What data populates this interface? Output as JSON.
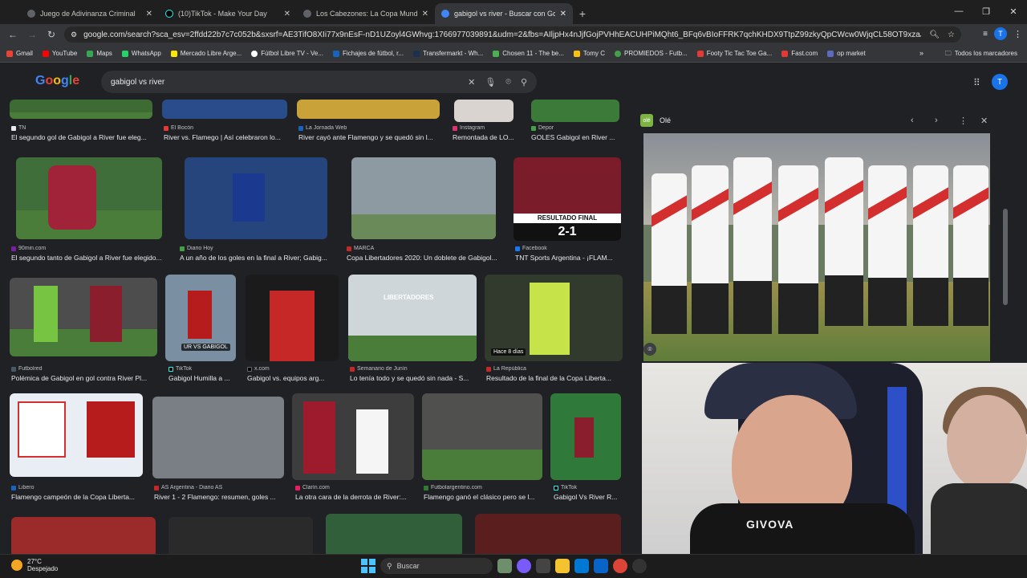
{
  "browser": {
    "tabs": [
      {
        "title": "Juego de Adivinanza Criminal",
        "color": "#5f6368"
      },
      {
        "title": "(10)TikTok - Make Your Day",
        "color": "#000000"
      },
      {
        "title": "Los Cabezones: La Copa Mundi",
        "color": "#5f6368"
      },
      {
        "title": "gabigol vs river - Buscar con Go",
        "color": "#4285f4"
      }
    ],
    "url": "google.com/search?sca_esv=2ffdd22b7c7c052b&sxsrf=AE3TifO8XIi77x9nEsF-nD1UZoyl4GWhvg:1766977039891&udm=2&fbs=AIljpHx4nJjfGojPVHhEACUHPiMQht6_BFq6vBIoFFRK7qchKHDX9TtpZ99zkyQpCWcw0WjqCL58OT9xzaJZWNwg8Tb-QmvZCiE...",
    "profile_initial": "T"
  },
  "bookmarks": [
    {
      "label": "Gmail",
      "color": "#ea4335"
    },
    {
      "label": "YouTube",
      "color": "#ff0000"
    },
    {
      "label": "Maps",
      "color": "#34a853"
    },
    {
      "label": "WhatsApp",
      "color": "#25d366"
    },
    {
      "label": "Mercado Libre Arge...",
      "color": "#ffe600"
    },
    {
      "label": "Fútbol Libre TV - Ve...",
      "color": "#ffffff"
    },
    {
      "label": "Fichajes de fútbol, r...",
      "color": "#1565c0"
    },
    {
      "label": "Transfermarkt - Wh...",
      "color": "#1a3151"
    },
    {
      "label": "Chosen 11 - The be...",
      "color": "#4caf50"
    },
    {
      "label": "Tomy C",
      "color": "#ffc107"
    },
    {
      "label": "PROMIEDOS - Futb...",
      "color": "#43a047"
    },
    {
      "label": "Footy Tic Tac Toe Ga...",
      "color": "#e53935"
    },
    {
      "label": "Fast.com",
      "color": "#e53935"
    },
    {
      "label": "op market",
      "color": "#5c6bc0"
    }
  ],
  "bookmarks_all": "Todos los marcadores",
  "google": {
    "logo": "Google",
    "query": "gabigol vs river"
  },
  "results": [
    {
      "source": "TN",
      "caption": "El segundo gol de Gabigol a River fue eleg..."
    },
    {
      "source": "El Bocón",
      "caption": "River vs. Flamego | Así celebraron lo..."
    },
    {
      "source": "La Jornada Web",
      "caption": "River cayó ante Flamengo y se quedó sin l..."
    },
    {
      "source": "Instagram",
      "caption": "Remontada de LO..."
    },
    {
      "source": "Depor",
      "caption": "GOLES Gabigol en River ..."
    },
    {
      "source": "90min.com",
      "caption": "El segundo tanto de Gabigol a River fue elegido..."
    },
    {
      "source": "Diario Hoy",
      "caption": "A un año de los goles en la final a River; Gabig..."
    },
    {
      "source": "MARCA",
      "caption": "Copa Libertadores 2020: Un doblete de Gabigol..."
    },
    {
      "source": "Facebook",
      "caption": "TNT Sports Argentina - ¡FLAM..."
    },
    {
      "source": "Futbolred",
      "caption": "Polémica de Gabigol en gol contra River Pl..."
    },
    {
      "source": "TikTok",
      "caption": "Gabigol Humilla a ..."
    },
    {
      "source": "x.com",
      "caption": "Gabigol vs. equipos arg..."
    },
    {
      "source": "Semanario de Junín",
      "caption": "Lo tenía todo y se quedó sin nada - S..."
    },
    {
      "source": "La República",
      "caption": "Resultado de la final de la Copa Liberta..."
    },
    {
      "source": "Libero",
      "caption": "Flamengo campeón de la Copa Liberta..."
    },
    {
      "source": "AS Argentina - Diario AS",
      "caption": "River 1 - 2 Flamengo: resumen, goles ..."
    },
    {
      "source": "Clarín.com",
      "caption": "La otra cara de la derrota de River:..."
    },
    {
      "source": "Futbolargentino.com",
      "caption": "Flamengo ganó el clásico pero se l..."
    },
    {
      "source": "TikTok",
      "caption": "Gabigol Vs River R..."
    }
  ],
  "overlays": {
    "resultado_final": "RESULTADO FINAL",
    "score": "2-1",
    "tiktok_tag": "UR VS GABIGOL",
    "hace": "Hace 8 días",
    "libertadores": "LIBERTADORES"
  },
  "preview": {
    "source": "Olé",
    "source_icon": "olé"
  },
  "webcam": {
    "shirt_brand": "GIVOVA"
  },
  "taskbar": {
    "temp": "27°C",
    "weather": "Despejado",
    "search": "Buscar"
  }
}
